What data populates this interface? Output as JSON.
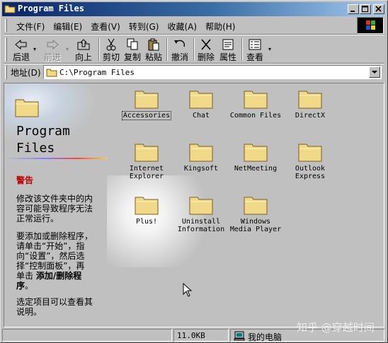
{
  "window": {
    "title": "Program Files"
  },
  "menu": {
    "items": [
      "文件(F)",
      "编辑(E)",
      "查看(V)",
      "转到(G)",
      "收藏(A)",
      "帮助(H)"
    ]
  },
  "toolbar": {
    "back": "后退",
    "forward": "前进",
    "up": "向上",
    "cut": "剪切",
    "copy": "复制",
    "paste": "粘贴",
    "undo": "撤消",
    "delete": "删除",
    "properties": "属性",
    "views": "查看"
  },
  "address": {
    "label": "地址(D)",
    "value": "C:\\Program Files"
  },
  "leftpane": {
    "title_line1": "Program",
    "title_line2": "Files",
    "warning": "警告",
    "p1_l1": "修改该文件夹中的内",
    "p1_l2": "容可能导致程序无法",
    "p1_l3": "正常运行。",
    "p2_l1": "要添加或删除程序，",
    "p2_l2": "请单击“开始”，指",
    "p2_l3": "向“设置”，然后选",
    "p2_l4": "择“控制面板”，再",
    "p2_l5_pre": "单击 ",
    "p2_l5_bold": "添加/删除程",
    "p2_l6_bold": "序",
    "p2_l6_post": "。",
    "p3_l1": "选定项目可以查看其",
    "p3_l2": "说明。"
  },
  "folders": [
    {
      "l1": "Accessories",
      "l2": ""
    },
    {
      "l1": "Chat",
      "l2": ""
    },
    {
      "l1": "Common Files",
      "l2": ""
    },
    {
      "l1": "DirectX",
      "l2": ""
    },
    {
      "l1": "Internet",
      "l2": "Explorer"
    },
    {
      "l1": "Kingsoft",
      "l2": ""
    },
    {
      "l1": "NetMeeting",
      "l2": ""
    },
    {
      "l1": "Outlook",
      "l2": "Express"
    },
    {
      "l1": "Plus!",
      "l2": ""
    },
    {
      "l1": "Uninstall",
      "l2": "Information"
    },
    {
      "l1": "Windows",
      "l2": "Media Player"
    }
  ],
  "status": {
    "size": "11.0KB",
    "zone": "我的电脑"
  },
  "watermark": "知乎 @穿越时间",
  "colors": {
    "titlebar_start": "#0a246a",
    "titlebar_end": "#a6caf0",
    "warning": "#c00000",
    "folder": "#f1d98a"
  }
}
